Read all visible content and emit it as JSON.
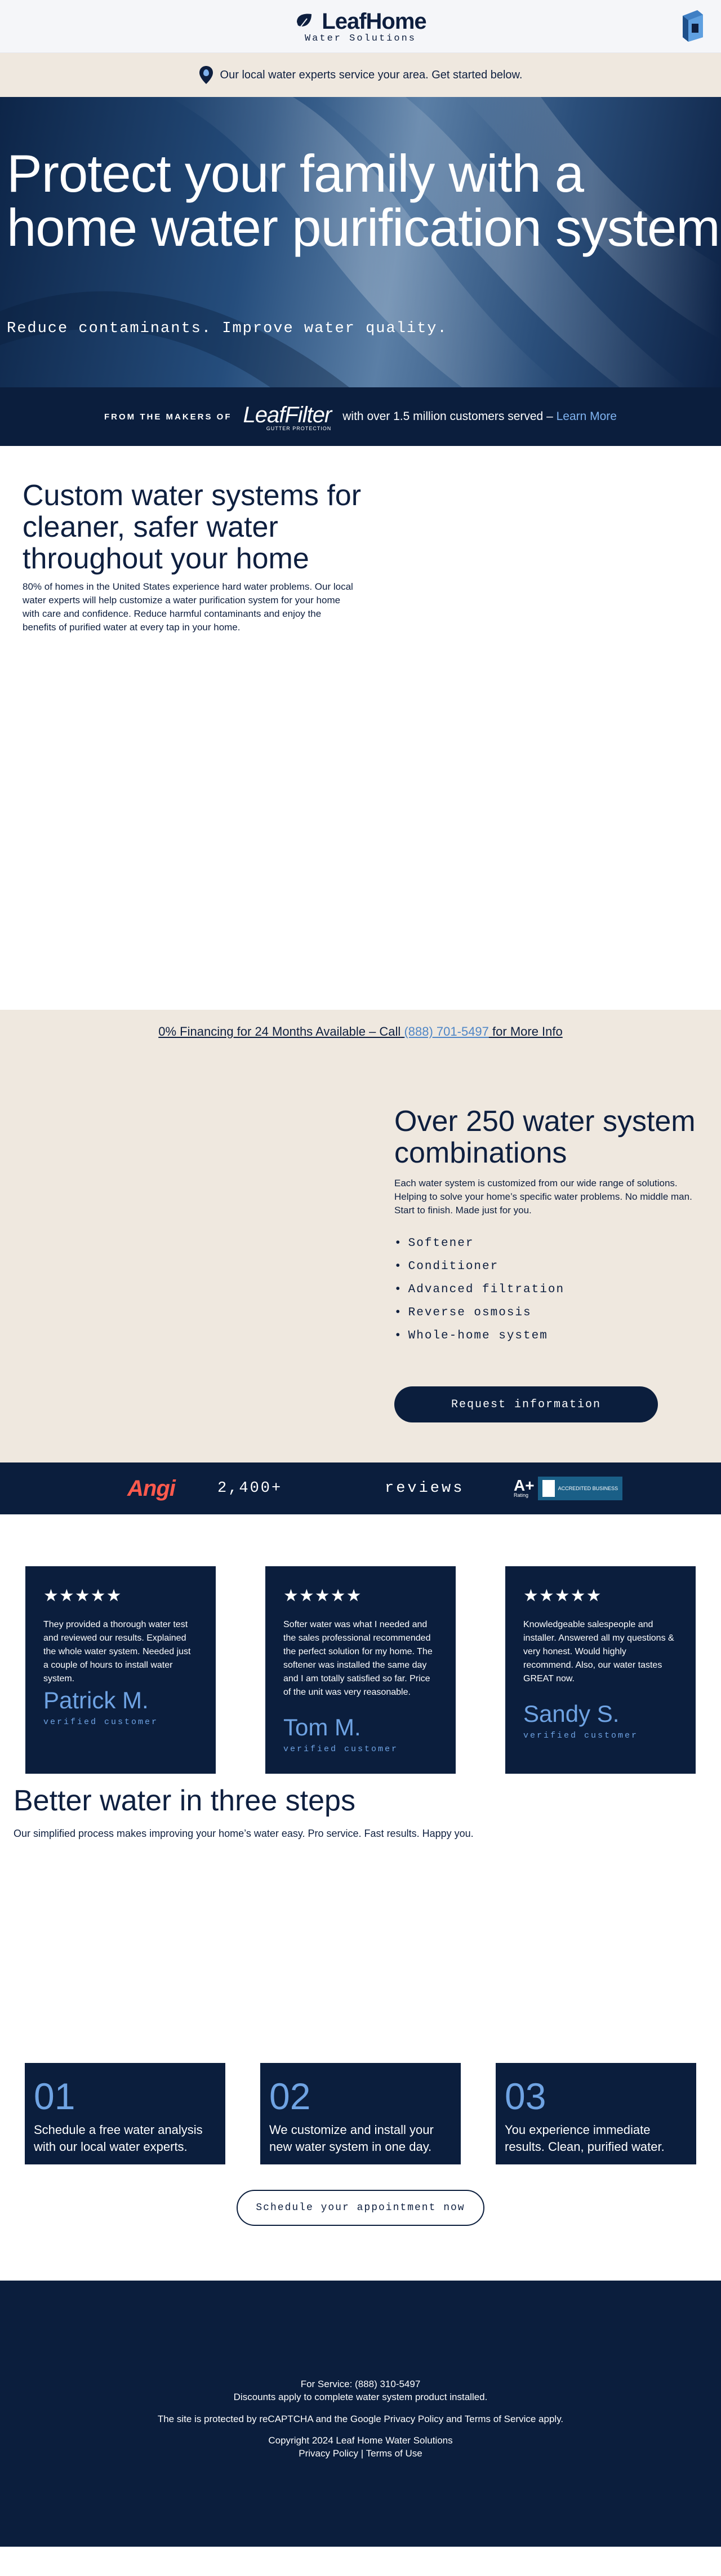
{
  "header": {
    "brand_name": "LeafHome",
    "brand_sub": "Water Solutions"
  },
  "local_banner": {
    "text": "Our local water experts service your area. Get started below."
  },
  "hero": {
    "title": "Protect your family with a home water purification system",
    "subtitle": "Reduce contaminants. Improve water quality."
  },
  "makers": {
    "prefix": "FROM THE MAKERS OF",
    "brand": "LeafFilter",
    "brand_tag": "GUTTER PROTECTION",
    "text": "with over 1.5 million customers served –",
    "link": "Learn More"
  },
  "intro": {
    "title": "Custom water systems for cleaner, safer water throughout your home",
    "body": "80% of homes in the United States experience hard water problems. Our local water experts will help customize a water purification system for your home with care and confidence. Reduce harmful contaminants and enjoy the benefits of purified water at every tap in your home."
  },
  "financing": {
    "text_before": "0% Financing for 24 Months Available – Call",
    "phone": "(888) 701-5497",
    "text_after": "for More Info"
  },
  "combos": {
    "title": "Over 250 water system combinations",
    "body": "Each water system is customized from our wide range of solutions. Helping to solve your home’s specific water problems. No middle man. Start to finish. Made just for you.",
    "items": [
      "Softener",
      "Conditioner",
      "Advanced filtration",
      "Reverse osmosis",
      "Whole-home system"
    ],
    "button": "Request information"
  },
  "ratings": {
    "angi": "Angi",
    "count": "2,400+",
    "label": "reviews",
    "bbb_grade": "A+",
    "bbb_rating": "Rating",
    "bbb_text": "ACCREDITED BUSINESS"
  },
  "testimonials": [
    {
      "stars": "★★★★★",
      "quote": "They provided a thorough water test and reviewed our results. Explained the whole water system. Needed just a couple of hours to install water system.",
      "name": "Patrick M.",
      "verified": "verified customer"
    },
    {
      "stars": "★★★★★",
      "quote": "Softer water was what I needed and the sales professional recommended the perfect solution for my home. The softener was installed the same day and I am totally satisfied so far. Price of the unit was very reasonable.",
      "name": "Tom M.",
      "verified": "verified customer"
    },
    {
      "stars": "★★★★★",
      "quote": "Knowledgeable salespeople and installer. Answered all my questions & very honest. Would highly recommend. Also, our water tastes GREAT now.",
      "name": "Sandy S.",
      "verified": "verified customer"
    }
  ],
  "steps": {
    "title": "Better water in three steps",
    "subtitle": "Our simplified process makes improving your home’s water easy. Pro service. Fast results. Happy you.",
    "items": [
      {
        "num": "01",
        "text": "Schedule a free water analysis with our local water experts."
      },
      {
        "num": "02",
        "text": "We customize and install your new water system in one day."
      },
      {
        "num": "03",
        "text": "You experience immediate results. Clean, purified water."
      }
    ],
    "button": "Schedule your appointment now"
  },
  "footer": {
    "service": "For Service: (888) 310-5497",
    "discounts": "Discounts apply to complete water system product installed.",
    "recaptcha": "The site is protected by reCAPTCHA and the Google Privacy Policy and Terms of Service apply.",
    "copyright": "Copyright 2024 Leaf Home Water Solutions",
    "privacy": "Privacy Policy",
    "separator": "|",
    "terms": "Terms of Use"
  },
  "colors": {
    "navy": "#0b1e3d",
    "sand": "#efe8df",
    "accent_blue": "#6fa3e3",
    "angi_red": "#ff5a4d"
  }
}
